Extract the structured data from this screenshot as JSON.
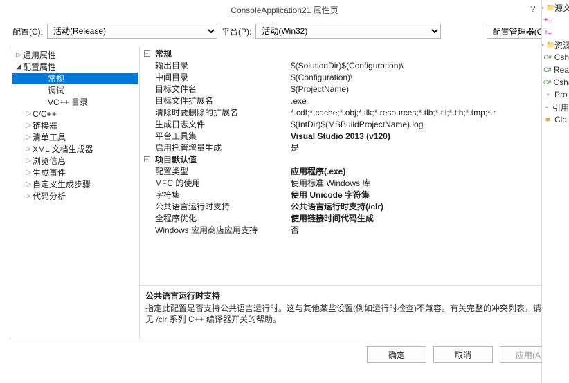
{
  "title": "ConsoleApplication21 属性页",
  "help_symbol": "?",
  "close_symbol": "×",
  "toolbar": {
    "config_label": "配置(C):",
    "config_value": "活动(Release)",
    "platform_label": "平台(P):",
    "platform_value": "活动(Win32)",
    "manager_button": "配置管理器(O)..."
  },
  "tree": [
    {
      "label": "通用属性",
      "indent": 0,
      "arrow": "closed"
    },
    {
      "label": "配置属性",
      "indent": 0,
      "arrow": "open"
    },
    {
      "label": "常规",
      "indent": 2,
      "selected": true
    },
    {
      "label": "调试",
      "indent": 2
    },
    {
      "label": "VC++ 目录",
      "indent": 2
    },
    {
      "label": "C/C++",
      "indent": 1,
      "arrow": "closed"
    },
    {
      "label": "链接器",
      "indent": 1,
      "arrow": "closed"
    },
    {
      "label": "清单工具",
      "indent": 1,
      "arrow": "closed"
    },
    {
      "label": "XML 文档生成器",
      "indent": 1,
      "arrow": "closed"
    },
    {
      "label": "浏览信息",
      "indent": 1,
      "arrow": "closed"
    },
    {
      "label": "生成事件",
      "indent": 1,
      "arrow": "closed"
    },
    {
      "label": "自定义生成步骤",
      "indent": 1,
      "arrow": "closed"
    },
    {
      "label": "代码分析",
      "indent": 1,
      "arrow": "closed"
    }
  ],
  "propgrid": [
    {
      "section": true,
      "label": "常规"
    },
    {
      "name": "输出目录",
      "value": "$(SolutionDir)$(Configuration)\\"
    },
    {
      "name": "中间目录",
      "value": "$(Configuration)\\"
    },
    {
      "name": "目标文件名",
      "value": "$(ProjectName)"
    },
    {
      "name": "目标文件扩展名",
      "value": ".exe"
    },
    {
      "name": "清除时要删除的扩展名",
      "value": "*.cdf;*.cache;*.obj;*.ilk;*.resources;*.tlb;*.tli;*.tlh;*.tmp;*.r"
    },
    {
      "name": "生成日志文件",
      "value": "$(IntDir)$(MSBuildProjectName).log"
    },
    {
      "name": "平台工具集",
      "value": "Visual Studio 2013 (v120)",
      "bold": true
    },
    {
      "name": "启用托管增量生成",
      "value": "是"
    },
    {
      "section": true,
      "label": "项目默认值"
    },
    {
      "name": "配置类型",
      "value": "应用程序(.exe)",
      "bold": true
    },
    {
      "name": "MFC 的使用",
      "value": "使用标准 Windows 库"
    },
    {
      "name": "字符集",
      "value": "使用 Unicode 字符集",
      "bold": true
    },
    {
      "name": "公共语言运行时支持",
      "value": "公共语言运行时支持(/clr)",
      "bold": true
    },
    {
      "name": "全程序优化",
      "value": "使用链接时间代码生成",
      "bold": true
    },
    {
      "name": "Windows 应用商店应用支持",
      "value": "否"
    }
  ],
  "description": {
    "title": "公共语言运行时支持",
    "body": "指定此配置是否支持公共语言运行时。这与其他某些设置(例如运行时检查)不兼容。有关完整的冲突列表，请参见 /clr 系列 C++ 编译器开关的帮助。"
  },
  "footer": {
    "ok": "确定",
    "cancel": "取消",
    "apply": "应用(A)"
  },
  "sidepanel": [
    {
      "icon": "folder",
      "label": "源文"
    },
    {
      "icon": "plus",
      "label": ""
    },
    {
      "icon": "plus",
      "label": ""
    },
    {
      "icon": "folder",
      "label": "资源"
    },
    {
      "icon": "cs",
      "label": "Csh"
    },
    {
      "icon": "cs",
      "label": "Rea"
    },
    {
      "icon": "cs",
      "label": "Csharp"
    },
    {
      "icon": "ref",
      "label": "Pro"
    },
    {
      "icon": "ref",
      "label": "引用"
    },
    {
      "icon": "cls",
      "label": "Cla"
    }
  ]
}
